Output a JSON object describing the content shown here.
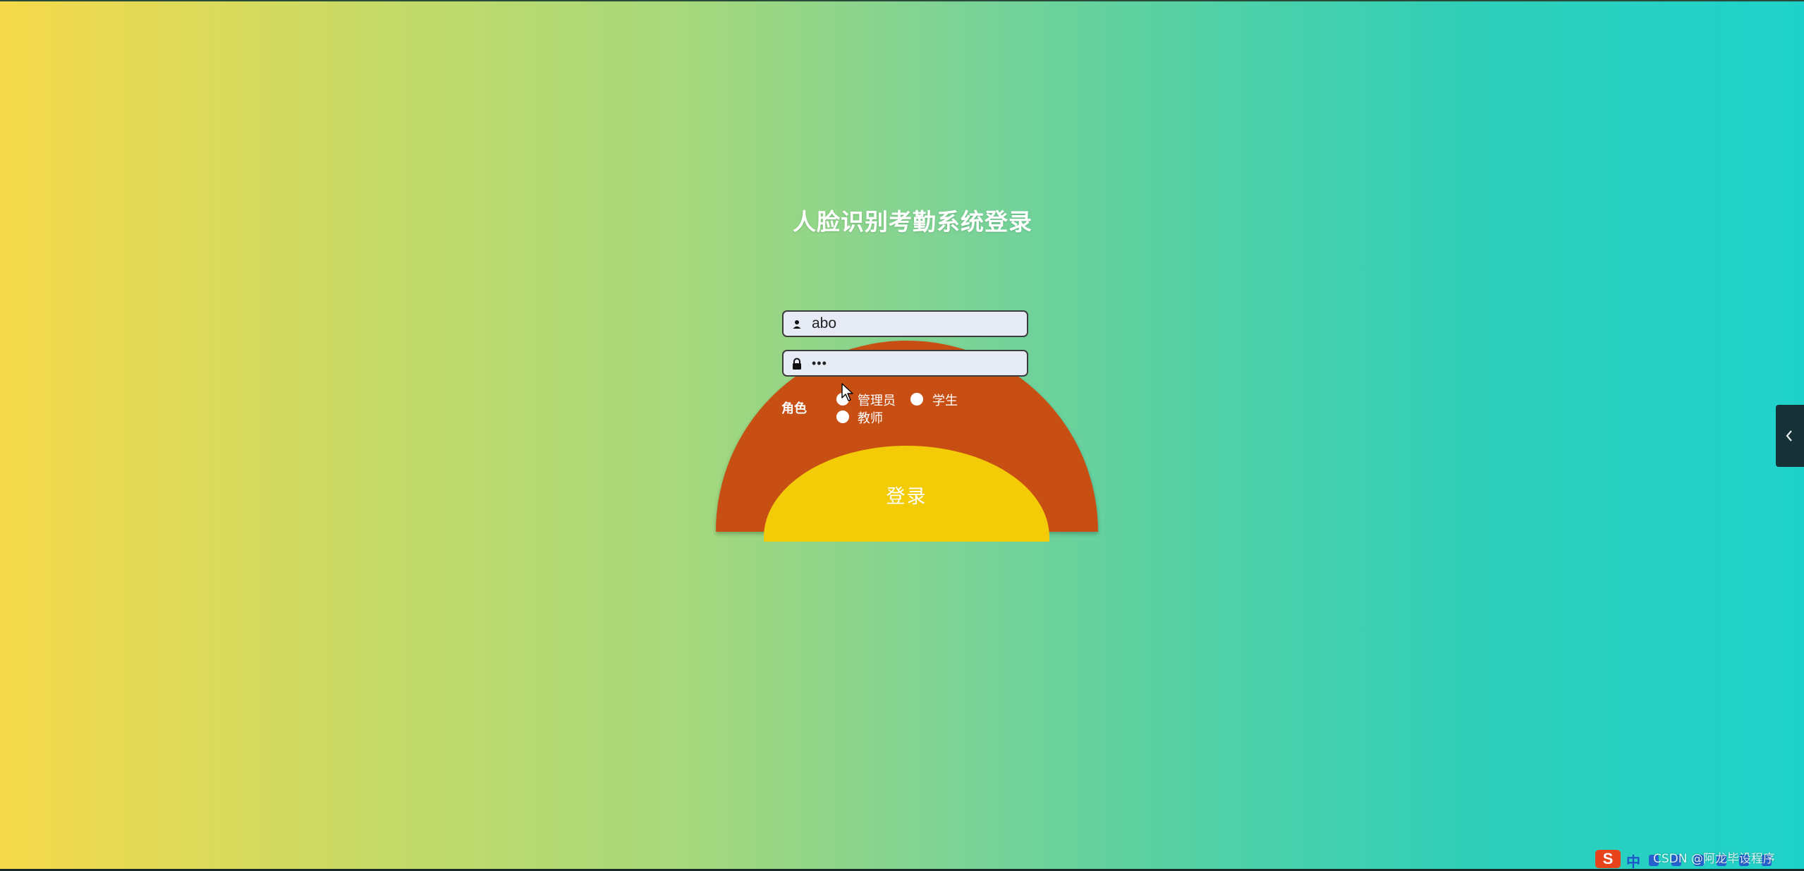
{
  "page": {
    "title": "人脸识别考勤系统登录"
  },
  "form": {
    "username_value": "abo",
    "password_value": "•••",
    "role_label": "角色",
    "roles": [
      {
        "label": "管理员",
        "selected": true
      },
      {
        "label": "学生",
        "selected": false
      },
      {
        "label": "教师",
        "selected": false
      }
    ],
    "login_label": "登录"
  },
  "ime": {
    "logo": "S",
    "lang": "中"
  },
  "watermark": "CSDN @阿龙毕设程序",
  "colors": {
    "outer_arc": "#c84f14",
    "login_button": "#f3cb06",
    "gradient_start": "#f5d94a",
    "gradient_end": "#1ed2cb"
  },
  "icons": {
    "username": "user-icon",
    "password": "lock-icon",
    "side_toggle": "chevron-left-icon"
  }
}
